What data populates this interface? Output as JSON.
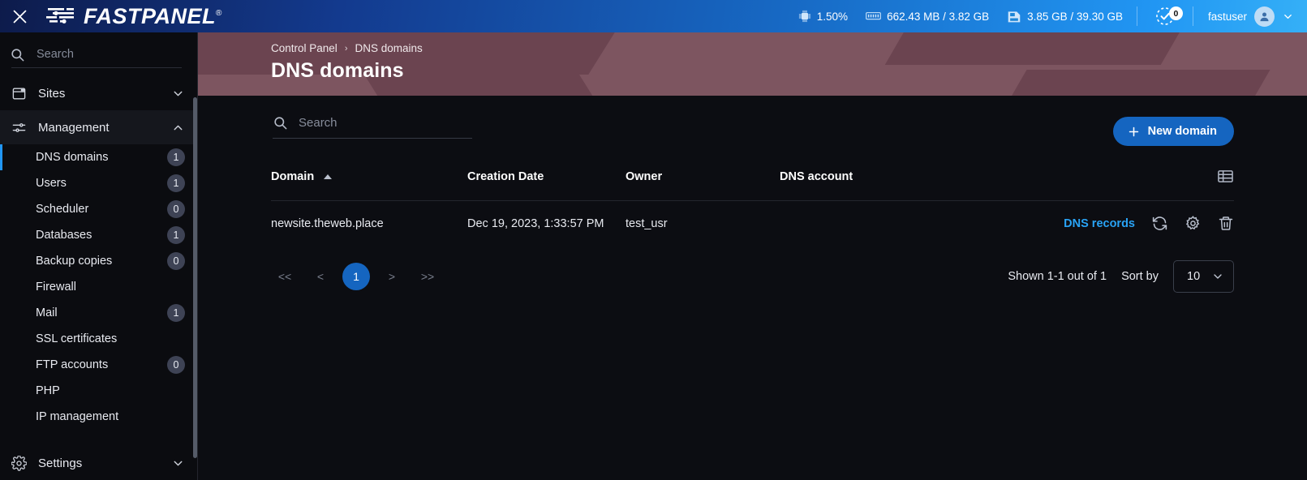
{
  "topbar": {
    "close_label": "close-icon",
    "brand": "FASTPANEL",
    "brand_mark": "®",
    "cpu": "1.50%",
    "ram": "662.43 MB / 3.82 GB",
    "disk": "3.85 GB / 39.30 GB",
    "tasks_count": "0",
    "username": "fastuser"
  },
  "sidebar": {
    "search_placeholder": "Search",
    "search_value": "",
    "groups": [
      {
        "label": "Sites",
        "expanded": false
      },
      {
        "label": "Management",
        "expanded": true
      },
      {
        "label": "Settings",
        "expanded": false
      }
    ],
    "items": [
      {
        "label": "DNS domains",
        "badge": "1",
        "selected": true
      },
      {
        "label": "Users",
        "badge": "1",
        "selected": false
      },
      {
        "label": "Scheduler",
        "badge": "0",
        "selected": false
      },
      {
        "label": "Databases",
        "badge": "1",
        "selected": false
      },
      {
        "label": "Backup copies",
        "badge": "0",
        "selected": false
      },
      {
        "label": "Firewall",
        "badge": "",
        "selected": false
      },
      {
        "label": "Mail",
        "badge": "1",
        "selected": false
      },
      {
        "label": "SSL certificates",
        "badge": "",
        "selected": false
      },
      {
        "label": "FTP accounts",
        "badge": "0",
        "selected": false
      },
      {
        "label": "PHP",
        "badge": "",
        "selected": false
      },
      {
        "label": "IP management",
        "badge": "",
        "selected": false
      }
    ]
  },
  "header": {
    "breadcrumb_root": "Control Panel",
    "breadcrumb_sep": "›",
    "breadcrumb_current": "DNS domains",
    "title": "DNS domains"
  },
  "toolbar": {
    "search_placeholder": "Search",
    "search_value": "",
    "new_button": "New domain",
    "new_button_plus": "+"
  },
  "table": {
    "columns": [
      "Domain",
      "Creation Date",
      "Owner",
      "DNS account"
    ],
    "sort_column": "Domain",
    "sort_direction": "asc",
    "rows": [
      {
        "domain": "newsite.theweb.place",
        "creation_date": "Dec 19, 2023, 1:33:57 PM",
        "owner": "test_usr",
        "dns_account": "",
        "action_link": "DNS records"
      }
    ]
  },
  "pagination": {
    "first": "<<",
    "prev": "<",
    "pages": [
      "1"
    ],
    "current_page": "1",
    "next": ">",
    "last": ">>",
    "shown": "Shown 1-1 out of 1",
    "sort_by_label": "Sort by",
    "page_size": "10"
  },
  "colors": {
    "accent_blue": "#1565c0",
    "link_blue": "#29a3f5",
    "header_mauve": "#7d5560",
    "page_bg": "#0c0d12",
    "sidebar_bg": "#0b0c10"
  }
}
